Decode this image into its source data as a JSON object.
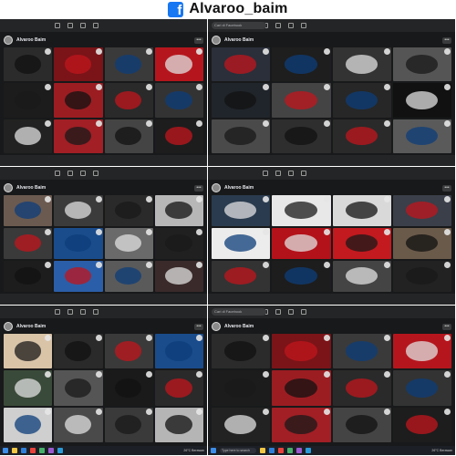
{
  "banner": {
    "handle": "Alvaroo_baim",
    "logo_icon": "facebook-icon",
    "logo_glyph": "f"
  },
  "tiles": [
    {
      "poster": "Alvaroo Baim",
      "search": "",
      "colors": [
        "#2b2b2b",
        "#7a1418",
        "#3a3a3a",
        "#b5161d",
        "#1c1c1c",
        "#9b1d22",
        "#2a2a2a",
        "#333",
        "#222",
        "#a11f25",
        "#444",
        "#1d1d1d"
      ]
    },
    {
      "poster": "Alvaroo Baim",
      "search": "Cari di Facebook",
      "colors": [
        "#2a2f3a",
        "#1e1e1e",
        "#333",
        "#555",
        "#20252b",
        "#444",
        "#272727",
        "#111",
        "#4a4a4a",
        "#2e2e2e",
        "#2a2a2a",
        "#5a5a5a"
      ]
    },
    {
      "poster": "Alvaroo Baim",
      "search": "",
      "colors": [
        "#6b5a50",
        "#3b3b3b",
        "#2a2a2a",
        "#b7b7b7",
        "#3a3a3a",
        "#1a4c8c",
        "#6a6a6a",
        "#202020",
        "#1d1d1d",
        "#2b5ea8",
        "#5a5a5a",
        "#3a2a2a"
      ]
    },
    {
      "poster": "Alvaroo Baim",
      "search": "",
      "colors": [
        "#2a3b4f",
        "#e8e8e8",
        "#d9d9d9",
        "#3a3f4a",
        "#ececec",
        "#b3121a",
        "#c21a1f",
        "#6a5a4a",
        "#333",
        "#1d1d1d",
        "#444",
        "#222"
      ]
    },
    {
      "poster": "Alvaroo Baim",
      "search": "",
      "colors": [
        "#d9c4a8",
        "#2a2a2a",
        "#3a3a3a",
        "#1a4c8c",
        "#3a4a3a",
        "#555",
        "#1a1a1a",
        "#2a2a2a",
        "#cfcfcf",
        "#4a4a4a",
        "#3a3a3a",
        "#b5b5b5"
      ]
    },
    {
      "poster": "Alvaroo Baim",
      "search": "Cari di Facebook",
      "colors": [
        "#2b2b2b",
        "#7a1418",
        "#3a3a3a",
        "#b5161d",
        "#1c1c1c",
        "#9b1d22",
        "#2a2a2a",
        "#333",
        "#222",
        "#a11f25",
        "#444",
        "#1d1d1d"
      ]
    }
  ],
  "taskbar": {
    "search": "Type here to search",
    "weather": "26°C Berawan"
  },
  "accent": "#1877f2"
}
